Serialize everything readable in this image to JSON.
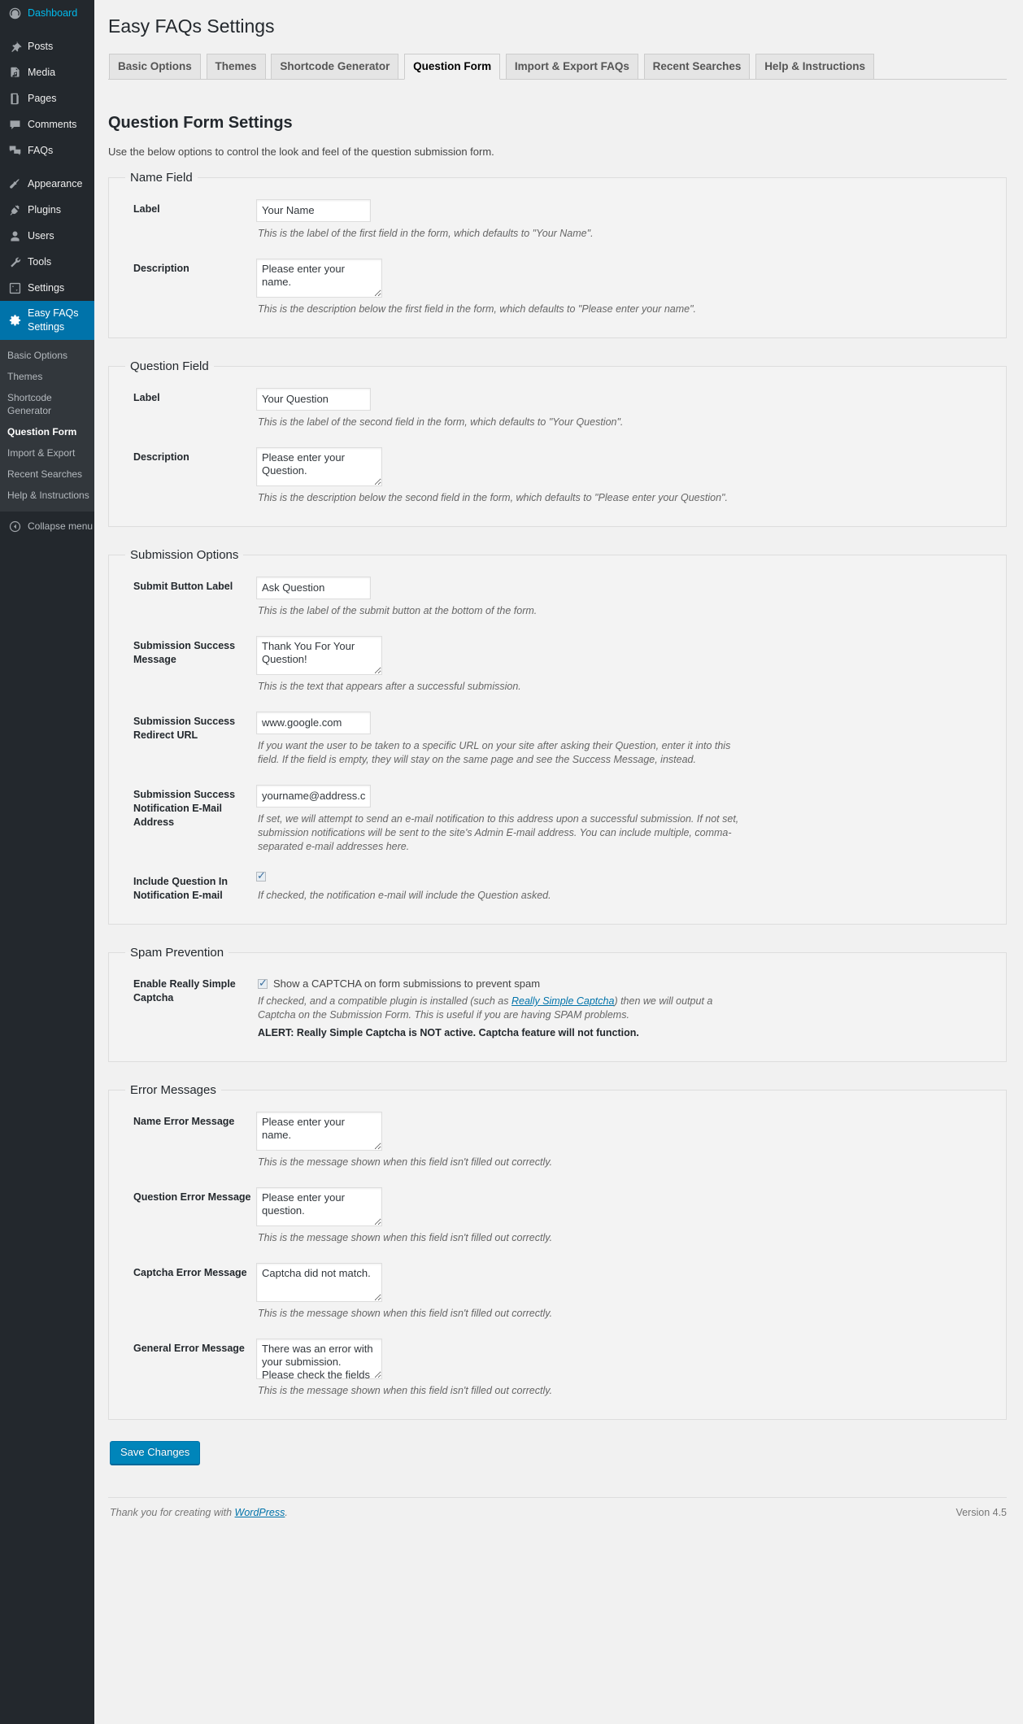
{
  "sidebar": {
    "items": [
      {
        "label": "Dashboard",
        "icon": "dashboard-icon"
      },
      {
        "label": "Posts",
        "icon": "pin-icon"
      },
      {
        "label": "Media",
        "icon": "media-icon"
      },
      {
        "label": "Pages",
        "icon": "pages-icon"
      },
      {
        "label": "Comments",
        "icon": "comments-icon"
      },
      {
        "label": "FAQs",
        "icon": "faqs-icon"
      },
      {
        "label": "Appearance",
        "icon": "appearance-icon"
      },
      {
        "label": "Plugins",
        "icon": "plugins-icon"
      },
      {
        "label": "Users",
        "icon": "users-icon"
      },
      {
        "label": "Tools",
        "icon": "tools-icon"
      },
      {
        "label": "Settings",
        "icon": "settings-icon"
      },
      {
        "label": "Easy FAQs Settings",
        "icon": "gear-icon"
      }
    ],
    "submenu": [
      {
        "label": "Basic Options"
      },
      {
        "label": "Themes"
      },
      {
        "label": "Shortcode Generator"
      },
      {
        "label": "Question Form"
      },
      {
        "label": "Import & Export"
      },
      {
        "label": "Recent Searches"
      },
      {
        "label": "Help & Instructions"
      }
    ],
    "collapse_label": "Collapse menu",
    "collapse_icon": "collapse-arrow-icon",
    "current_item": "Easy FAQs Settings",
    "current_submenu": "Question Form"
  },
  "header": {
    "title": "Easy FAQs Settings"
  },
  "tabs": [
    {
      "label": "Basic Options",
      "active": false
    },
    {
      "label": "Themes",
      "active": false
    },
    {
      "label": "Shortcode Generator",
      "active": false
    },
    {
      "label": "Question Form",
      "active": true
    },
    {
      "label": "Import & Export FAQs",
      "active": false
    },
    {
      "label": "Recent Searches",
      "active": false
    },
    {
      "label": "Help & Instructions",
      "active": false
    }
  ],
  "page": {
    "section_title": "Question Form Settings",
    "intro": "Use the below options to control the look and feel of the question submission form."
  },
  "name_field": {
    "legend": "Name Field",
    "label_label": "Label",
    "label_value": "Your Name",
    "label_desc": "This is the label of the first field in the form, which defaults to \"Your Name\".",
    "desc_label": "Description",
    "desc_value": "Please enter your name.",
    "desc_desc": "This is the description below the first field in the form, which defaults to \"Please enter your name\"."
  },
  "question_field": {
    "legend": "Question Field",
    "label_label": "Label",
    "label_value": "Your Question",
    "label_desc": "This is the label of the second field in the form, which defaults to \"Your Question\".",
    "desc_label": "Description",
    "desc_value": "Please enter your Question.",
    "desc_desc": "This is the description below the second field in the form, which defaults to \"Please enter your Question\"."
  },
  "submission_options": {
    "legend": "Submission Options",
    "submit_label_label": "Submit Button Label",
    "submit_label_value": "Ask Question",
    "submit_label_desc": "This is the label of the submit button at the bottom of the form.",
    "success_msg_label": "Submission Success Message",
    "success_msg_value": "Thank You For Your Question!",
    "success_msg_desc": "This is the text that appears after a successful submission.",
    "redirect_label": "Submission Success Redirect URL",
    "redirect_value": "www.google.com",
    "redirect_desc": "If you want the user to be taken to a specific URL on your site after asking their Question, enter it into this field. If the field is empty, they will stay on the same page and see the Success Message, instead.",
    "email_label": "Submission Success Notification E-Mail Address",
    "email_value": "yourname@address.com",
    "email_desc": "If set, we will attempt to send an e-mail notification to this address upon a successful submission. If not set, submission notifications will be sent to the site's Admin E-mail address. You can include multiple, comma-separated e-mail addresses here.",
    "include_question_label": "Include Question In Notification E-mail",
    "include_question_checked": true,
    "include_question_desc": "If checked, the notification e-mail will include the Question asked."
  },
  "spam_prevention": {
    "legend": "Spam Prevention",
    "captcha_label": "Enable Really Simple Captcha",
    "captcha_checked": true,
    "captcha_checkbox_text": "Show a CAPTCHA on form submissions to prevent spam",
    "captcha_desc_pre": "If checked, and a compatible plugin is installed (such as ",
    "captcha_desc_link": "Really Simple Captcha",
    "captcha_desc_post": ") then we will output a Captcha on the Submission Form. This is useful if you are having SPAM problems.",
    "captcha_alert": "ALERT: Really Simple Captcha is NOT active. Captcha feature will not function."
  },
  "error_messages": {
    "legend": "Error Messages",
    "shared_desc": "This is the message shown when this field isn't filled out correctly.",
    "rows": [
      {
        "label": "Name Error Message",
        "value": "Please enter your name."
      },
      {
        "label": "Question Error Message",
        "value": "Please enter your question."
      },
      {
        "label": "Captcha Error Message",
        "value": "Captcha did not match."
      },
      {
        "label": "General Error Message",
        "value": "There was an error with your submission.  Please check the fields and try"
      }
    ]
  },
  "footer": {
    "save_label": "Save Changes",
    "thanks_pre": "Thank you for creating with ",
    "thanks_link": "WordPress",
    "thanks_post": ".",
    "version": "Version 4.5"
  }
}
